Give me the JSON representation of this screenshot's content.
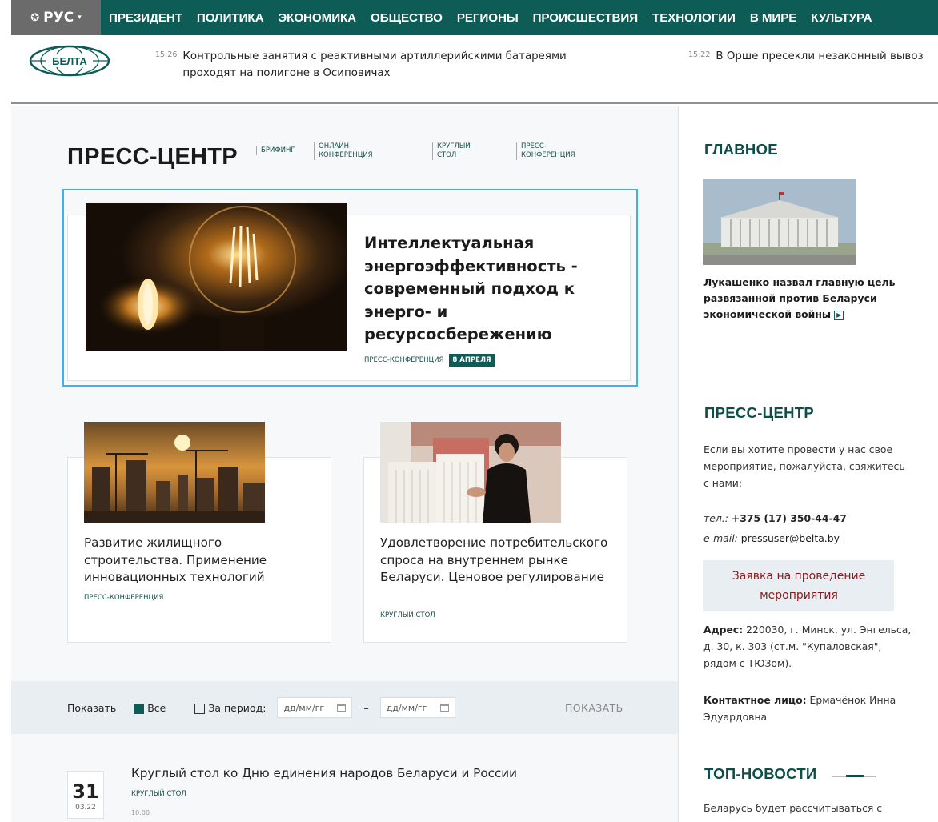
{
  "nav": {
    "lang": "РУС",
    "items": [
      "ПРЕЗИДЕНТ",
      "ПОЛИТИКА",
      "ЭКОНОМИКА",
      "ОБЩЕСТВО",
      "РЕГИОНЫ",
      "ПРОИСШЕСТВИЯ",
      "ТЕХНОЛОГИИ",
      "В МИРЕ",
      "КУЛЬТУРА"
    ]
  },
  "logo": {
    "text": "БЕЛТА"
  },
  "ticker": [
    {
      "time": "15:26",
      "text": "Контрольные занятия с реактивными артиллерийскими батареями проходят на полигоне в Осиповичах"
    },
    {
      "time": "15:22",
      "text": "В Орше пресекли незаконный вывоз"
    }
  ],
  "press_center": {
    "title": "ПРЕСС-ЦЕНТР",
    "tabs": [
      "БРИФИНГ",
      "ОНЛАЙН-\nКОНФЕРЕНЦИЯ",
      "КРУГЛЫЙ\nСТОЛ",
      "ПРЕСС-\nКОНФЕРЕНЦИЯ"
    ]
  },
  "featured": {
    "title": "Интеллектуальная энергоэффективность - современный подход к энерго- и ресурсосбережению",
    "tag": "ПРЕСС-КОНФЕРЕНЦИЯ",
    "date": "8 АПРЕЛЯ"
  },
  "cards": [
    {
      "title": "Развитие жилищного строительства. Применение инновационных технологий",
      "tag": "ПРЕСС-КОНФЕРЕНЦИЯ"
    },
    {
      "title": "Удовлетворение потребительского спроса на внутреннем рынке Беларуси. Ценовое регулирование",
      "tag": "КРУГЛЫЙ СТОЛ"
    }
  ],
  "filter": {
    "show_label": "Показать",
    "all_label": "Все",
    "period_label": "За период:",
    "date_from_placeholder": "дд/мм/гг",
    "date_to_placeholder": "дд/мм/гг",
    "dash": "–",
    "button": "ПОКАЗАТЬ"
  },
  "event": {
    "day": "31",
    "month": "03.22",
    "title": "Круглый стол ко Дню единения народов Беларуси и России",
    "tag": "КРУГЛЫЙ СТОЛ",
    "time": "10:00"
  },
  "sidebar": {
    "main_heading": "ГЛАВНОЕ",
    "main_title": "Лукашенко назвал главную цель развязанной против Беларуси экономической войны",
    "pc_heading": "ПРЕСС-ЦЕНТР",
    "pc_text": "Если вы хотите провести у нас свое мероприятие, пожалуйста, свяжитесь с нами:",
    "phone_label": "тел.:",
    "phone": "+375 (17) 350-44-47",
    "email_label": "e-mail:",
    "email": "pressuser@belta.by",
    "apply_button": "Заявка на проведение мероприятия",
    "address_label": "Адрес:",
    "address": "220030, г. Минск, ул. Энгельса, д. 30, к. 303 (ст.м. \"Купаловская\", рядом с ТЮЗом).",
    "contact_label": "Контактное лицо:",
    "contact": "Ермачёнок Инна Эдуардовна",
    "top_heading": "ТОП-НОВОСТИ",
    "top_first": "Беларусь будет рассчитываться с"
  },
  "colors": {
    "brand": "#0d5c55",
    "highlight": "#3fb2ed",
    "apply_text": "#8b1a1a"
  }
}
